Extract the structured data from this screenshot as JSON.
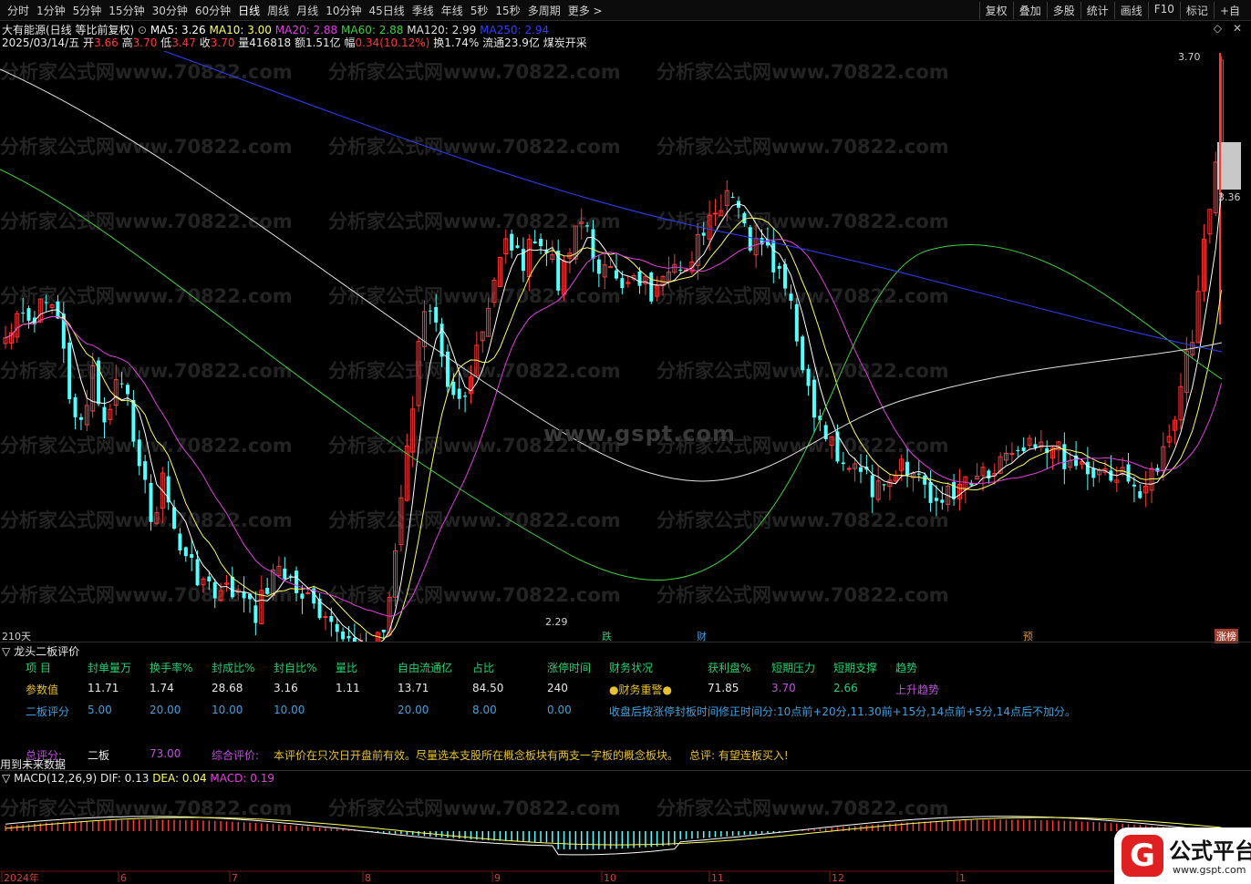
{
  "toolbar": {
    "periods": [
      "分时",
      "1分钟",
      "5分钟",
      "15分钟",
      "30分钟",
      "60分钟",
      "日线",
      "周线",
      "月线",
      "10分钟",
      "45日线",
      "季线",
      "年线",
      "5秒",
      "15秒",
      "多周期",
      "更多 >"
    ],
    "tools": [
      "复权",
      "叠加",
      "多股",
      "统计",
      "画线",
      "F10",
      "标记",
      "+自"
    ]
  },
  "header": {
    "stock_title": "大有能源(日线 等比前复权)",
    "ma5": "MA5: 3.26",
    "ma10": "MA10: 3.00",
    "ma20": "MA20: 2.88",
    "ma60": "MA60: 2.88",
    "ma120": "MA120: 2.99",
    "ma250": "MA250: 2.94",
    "date": "2025/03/14/五",
    "open_label": "开",
    "open": "3.66",
    "high_label": "高",
    "high": "3.70",
    "low_label": "低",
    "low": "3.47",
    "close_label": "收",
    "close": "3.70",
    "volume": "量416818",
    "amount": "额1.51亿",
    "change_label": "幅",
    "change": "0.34(10.12%)",
    "turnover": "换1.74%",
    "float_value": "流通23.9亿",
    "concept": "煤炭开采"
  },
  "chart": {
    "price_top": "3.70",
    "price_mid": "3.36",
    "price_low": "2.29",
    "days_label": "210天",
    "markers": [
      "跌",
      "财",
      "预",
      "涨榜"
    ],
    "watermark_text": "分析家公式网www.70822.com",
    "center_watermark": "www.gspt.com"
  },
  "panel": {
    "title": "龙头二板评价",
    "headers": [
      "项 目",
      "封单量万",
      "换手率%",
      "封成比%",
      "封自比%",
      "量比",
      "自由流通亿",
      "占比",
      "涨停时间",
      "财务状况",
      "获利盘%",
      "短期压力",
      "短期支撑",
      "趋势"
    ],
    "param_label": "参数值",
    "param_values": [
      "11.71",
      "1.74",
      "28.68",
      "3.16",
      "1.11",
      "13.71",
      "84.50",
      "240",
      "●财务重警●",
      "71.85",
      "3.70",
      "2.66",
      "上升趋势"
    ],
    "score_label": "二板评分",
    "score_values": [
      "5.00",
      "20.00",
      "10.00",
      "10.00",
      "20.00",
      "8.00",
      "0.00"
    ],
    "score_note": "收盘后按涨停封板时间修正时间分:10点前+20分,11.30前+15分,14点前+5分,14点后不加分。",
    "total_label": "总评分:",
    "total_kind": "二板",
    "total_value": "73.00",
    "comment_label": "综合评价:",
    "comment_text": "本评价在只次日开盘前有效。尽量选本支股所在概念板块有两支一字板的概念板块。",
    "verdict": "总评: 有望连板买入!",
    "future_note": "用到未来数据"
  },
  "macd": {
    "title": "MACD(12,26,9)",
    "dif": "DIF: 0.13",
    "dea": "DEA: 0.04",
    "macd": "MACD: 0.19",
    "months": [
      "2024年",
      "6",
      "7",
      "8",
      "9",
      "10",
      "11",
      "12",
      "1"
    ]
  },
  "brand": {
    "logo_letter": "G",
    "name": "公式平台",
    "url": "www.gspt.com"
  },
  "colors": {
    "up": "#ff3838",
    "down": "#54ffff",
    "ma5": "#ffffff",
    "ma10": "#ffff60",
    "ma20": "#e040e0",
    "ma60": "#40d040",
    "ma120": "#e0e0e0",
    "ma250": "#3040ff"
  },
  "chart_data": {
    "type": "candlestick",
    "y_range": [
      2.29,
      3.7
    ],
    "last_close": 3.7
  }
}
